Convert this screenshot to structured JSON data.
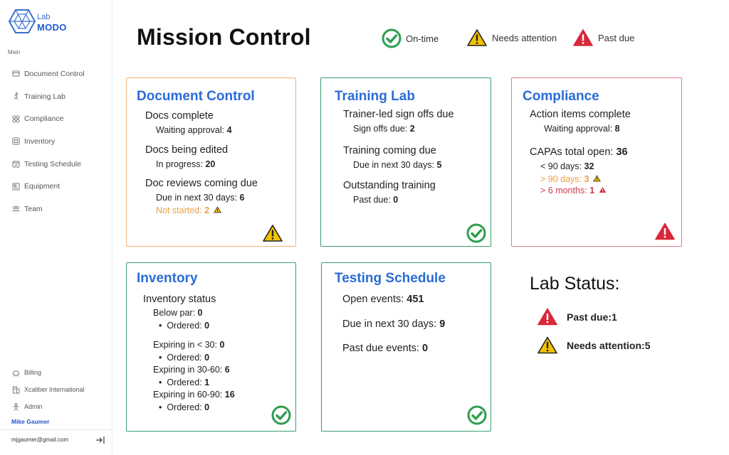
{
  "app": {
    "logo_lab": "Lab",
    "logo_modo": "MODO"
  },
  "sidebar": {
    "section_label": "Main",
    "items": [
      {
        "label": "Document Control",
        "icon": "document-icon"
      },
      {
        "label": "Training Lab",
        "icon": "runner-icon"
      },
      {
        "label": "Compliance",
        "icon": "grid-icon"
      },
      {
        "label": "Inventory",
        "icon": "box-icon"
      },
      {
        "label": "Testing Schedule",
        "icon": "calendar-check-icon"
      },
      {
        "label": "Equipment",
        "icon": "equipment-icon"
      },
      {
        "label": "Team",
        "icon": "team-icon"
      }
    ],
    "bottom_items": [
      {
        "label": "Billing",
        "icon": "piggy-bank-icon"
      },
      {
        "label": "Xcaliber International",
        "icon": "building-icon"
      },
      {
        "label": "Admin",
        "icon": "admin-icon"
      }
    ],
    "user_name": "Mike Gaumer",
    "user_email": "mjgaumer@gmail.com"
  },
  "header": {
    "title": "Mission Control",
    "legend": {
      "on_time": "On-time",
      "needs_attention": "Needs attention",
      "past_due": "Past due"
    }
  },
  "cards": {
    "document_control": {
      "title": "Document Control",
      "status": "needs-attention",
      "docs_complete": "Docs complete",
      "waiting_approval_label": "Waiting approval: ",
      "waiting_approval_value": "4",
      "docs_edited": "Docs being edited",
      "in_progress_label": "In progress: ",
      "in_progress_value": "20",
      "reviews_due": "Doc reviews coming due",
      "due_30_label": "Due in next 30 days: ",
      "due_30_value": "6",
      "not_started_label": "Not started: ",
      "not_started_value": "2"
    },
    "training_lab": {
      "title": "Training Lab",
      "status": "on-time",
      "signoffs_due": "Trainer-led sign offs due",
      "signoffs_label": "Sign offs due: ",
      "signoffs_value": "2",
      "training_due": "Training coming due",
      "due_30_label": "Due in next 30 days: ",
      "due_30_value": "5",
      "outstanding": "Outstanding training",
      "past_due_label": "Past due: ",
      "past_due_value": "0"
    },
    "compliance": {
      "title": "Compliance",
      "status": "past-due",
      "action_items": "Action items complete",
      "waiting_approval_label": "Waiting approval: ",
      "waiting_approval_value": "8",
      "capas_label": "CAPAs total open: ",
      "capas_value": "36",
      "lt90_label": "< 90 days: ",
      "lt90_value": "32",
      "gt90_label": "> 90 days: ",
      "gt90_value": "3",
      "gt6m_label": ">  6 months: ",
      "gt6m_value": "1"
    },
    "inventory": {
      "title": "Inventory",
      "status": "on-time",
      "inventory_status": "Inventory status",
      "below_par_label": "Below par: ",
      "below_par_value": "0",
      "ordered_label": "Ordered: ",
      "ordered_1": "0",
      "exp30_label": "Expiring in < 30: ",
      "exp30_value": "0",
      "ordered_2": "0",
      "exp3060_label": "Expiring in 30-60: ",
      "exp3060_value": "6",
      "ordered_3": "1",
      "exp6090_label": "Expiring in 60-90: ",
      "exp6090_value": "16",
      "ordered_4": "0"
    },
    "testing_schedule": {
      "title": "Testing Schedule",
      "status": "on-time",
      "open_label": "Open events: ",
      "open_value": "451",
      "due_30_label": "Due in next 30 days: ",
      "due_30_value": "9",
      "past_due_label": "Past due events: ",
      "past_due_value": "0"
    }
  },
  "lab_status": {
    "title": "Lab Status:",
    "past_due_label": "Past due: ",
    "past_due_value": "1",
    "needs_attention_label": "Needs attention: ",
    "needs_attention_value": "5"
  },
  "colors": {
    "accent": "#2b6bd6",
    "on_time": "#2e9e4f",
    "needs_attention": "#f2c200",
    "past_due": "#d8283c",
    "card_orange_border": "#f0b27a",
    "card_green_border": "#3a9c72",
    "card_red_border": "#e07a86"
  }
}
